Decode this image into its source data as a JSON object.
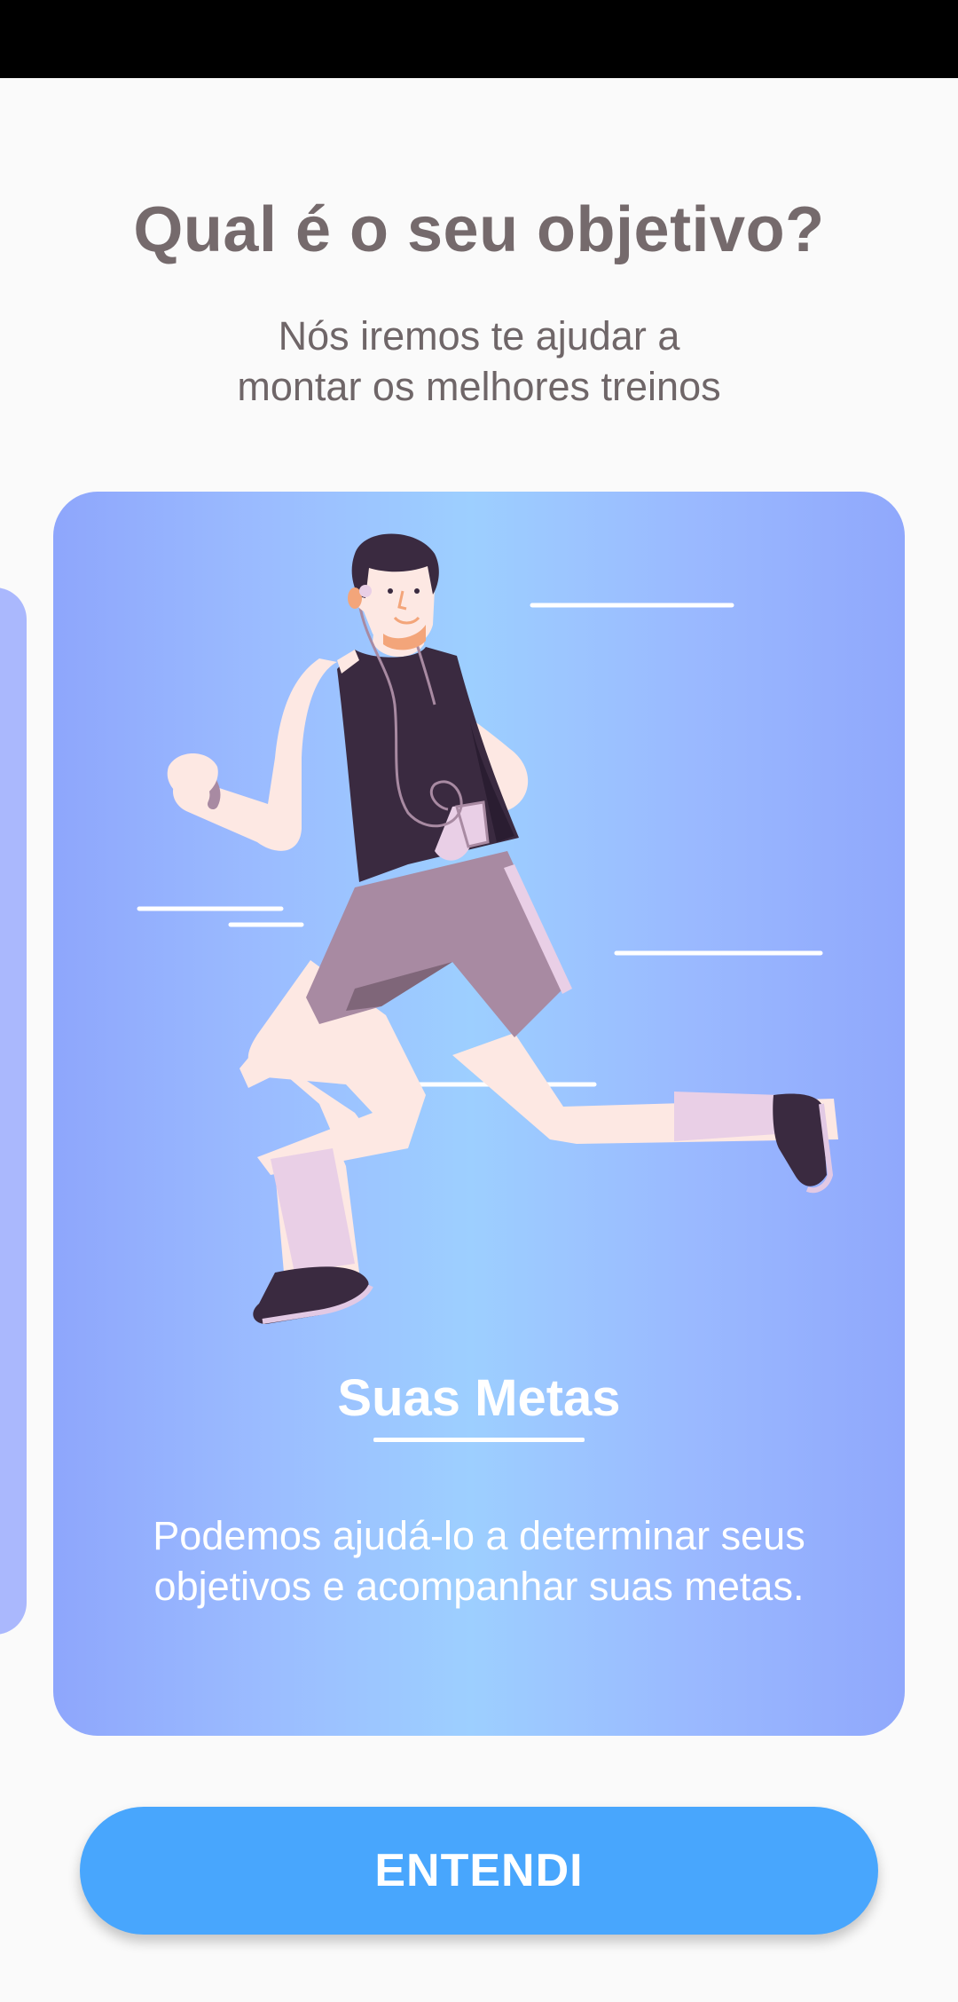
{
  "header": {
    "title": "Qual é o seu objetivo?",
    "subtitle_line1": "Nós iremos te ajudar a",
    "subtitle_line2": "montar os melhores treinos"
  },
  "card": {
    "illustration": "running-man-illustration",
    "title": "Suas Metas",
    "description": "Podemos ajudá-lo a determinar seus objetivos e acompanhar suas metas."
  },
  "button": {
    "label": "ENTENDI"
  },
  "colors": {
    "background": "#fafafa",
    "card_gradient_edge": "#8ea6fc",
    "card_gradient_center": "#9dcfff",
    "button": "#48a6fd",
    "title_text": "#756a6c"
  }
}
